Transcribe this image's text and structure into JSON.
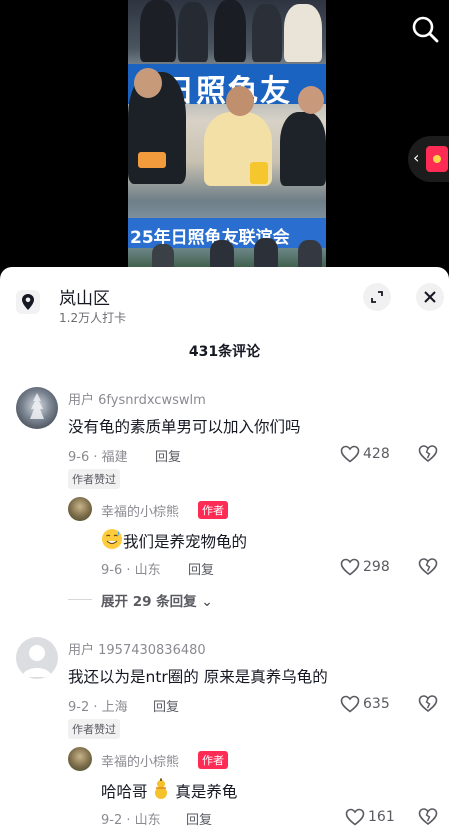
{
  "video": {
    "banner_text": "日照龟友",
    "bottom_text": "25年日照龟友联谊会"
  },
  "location": {
    "title": "岚山区",
    "subtitle": "1.2万人打卡"
  },
  "comments_count": "431条评论",
  "comments": [
    {
      "user": "用户 6fysnrdxcwswlm",
      "text": "没有龟的素质单男可以加入你们吗",
      "date_place": "9-6 · 福建",
      "reply_label": "回复",
      "likes": "428",
      "liked_by_author": "作者赞过",
      "reply": {
        "user": "幸福的小棕熊",
        "author_tag": "作者",
        "text": "我们是养宠物龟的",
        "date_place": "9-6 · 山东",
        "reply_label": "回复",
        "likes": "298"
      },
      "expand": "展开 29 条回复"
    },
    {
      "user": "用户 1957430836480",
      "text": "我还以为是ntr圈的 原来是真养乌龟的",
      "date_place": "9-2 · 上海",
      "reply_label": "回复",
      "likes": "635",
      "liked_by_author": "作者赞过",
      "reply": {
        "user": "幸福的小棕熊",
        "author_tag": "作者",
        "text_before": "哈哈哥",
        "text_after": "真是养龟",
        "date_place": "9-2 · 山东",
        "reply_label": "回复",
        "likes": "161"
      }
    }
  ],
  "colors": {
    "accent": "#fe2c55",
    "text": "#161823",
    "muted": "#8a8b91"
  }
}
